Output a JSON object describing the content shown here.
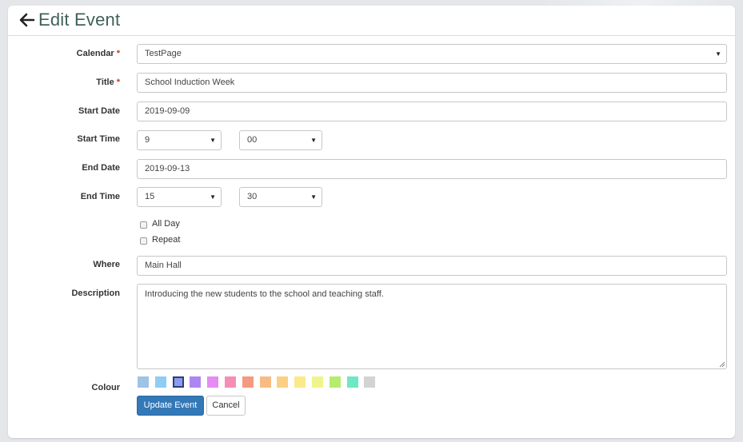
{
  "header": {
    "title": "Edit Event"
  },
  "form": {
    "calendar": {
      "label": "Calendar",
      "value": "TestPage"
    },
    "title": {
      "label": "Title",
      "value": "School Induction Week"
    },
    "required_mark": "*",
    "start_date": {
      "label": "Start Date",
      "value": "2019-09-09"
    },
    "start_time": {
      "label": "Start Time",
      "hour": "9",
      "minute": "00"
    },
    "end_date": {
      "label": "End Date",
      "value": "2019-09-13"
    },
    "end_time": {
      "label": "End Time",
      "hour": "15",
      "minute": "30"
    },
    "all_day": {
      "label": "All Day",
      "checked": false
    },
    "repeat": {
      "label": "Repeat",
      "checked": false
    },
    "where": {
      "label": "Where",
      "value": "Main Hall"
    },
    "description": {
      "label": "Description",
      "value": "Introducing the new students to the school and teaching staff."
    },
    "colour": {
      "label": "Colour",
      "selected_index": 2,
      "swatches": [
        "#9ec3e6",
        "#8fcdf5",
        "#8c9cf4",
        "#ae86f2",
        "#e48cf2",
        "#f58eb7",
        "#f59a80",
        "#f8bc82",
        "#fbd082",
        "#fbe98a",
        "#eef58c",
        "#b5ec6d",
        "#6ee8c4",
        "#d3d3d3"
      ]
    }
  },
  "actions": {
    "update_label": "Update Event",
    "cancel_label": "Cancel"
  },
  "icons": {
    "back": "arrow-left-icon",
    "dropdown": "caret-down-icon"
  },
  "colors": {
    "title": "#41615a",
    "primary_button": "#3378b7",
    "required": "#c0392b"
  }
}
